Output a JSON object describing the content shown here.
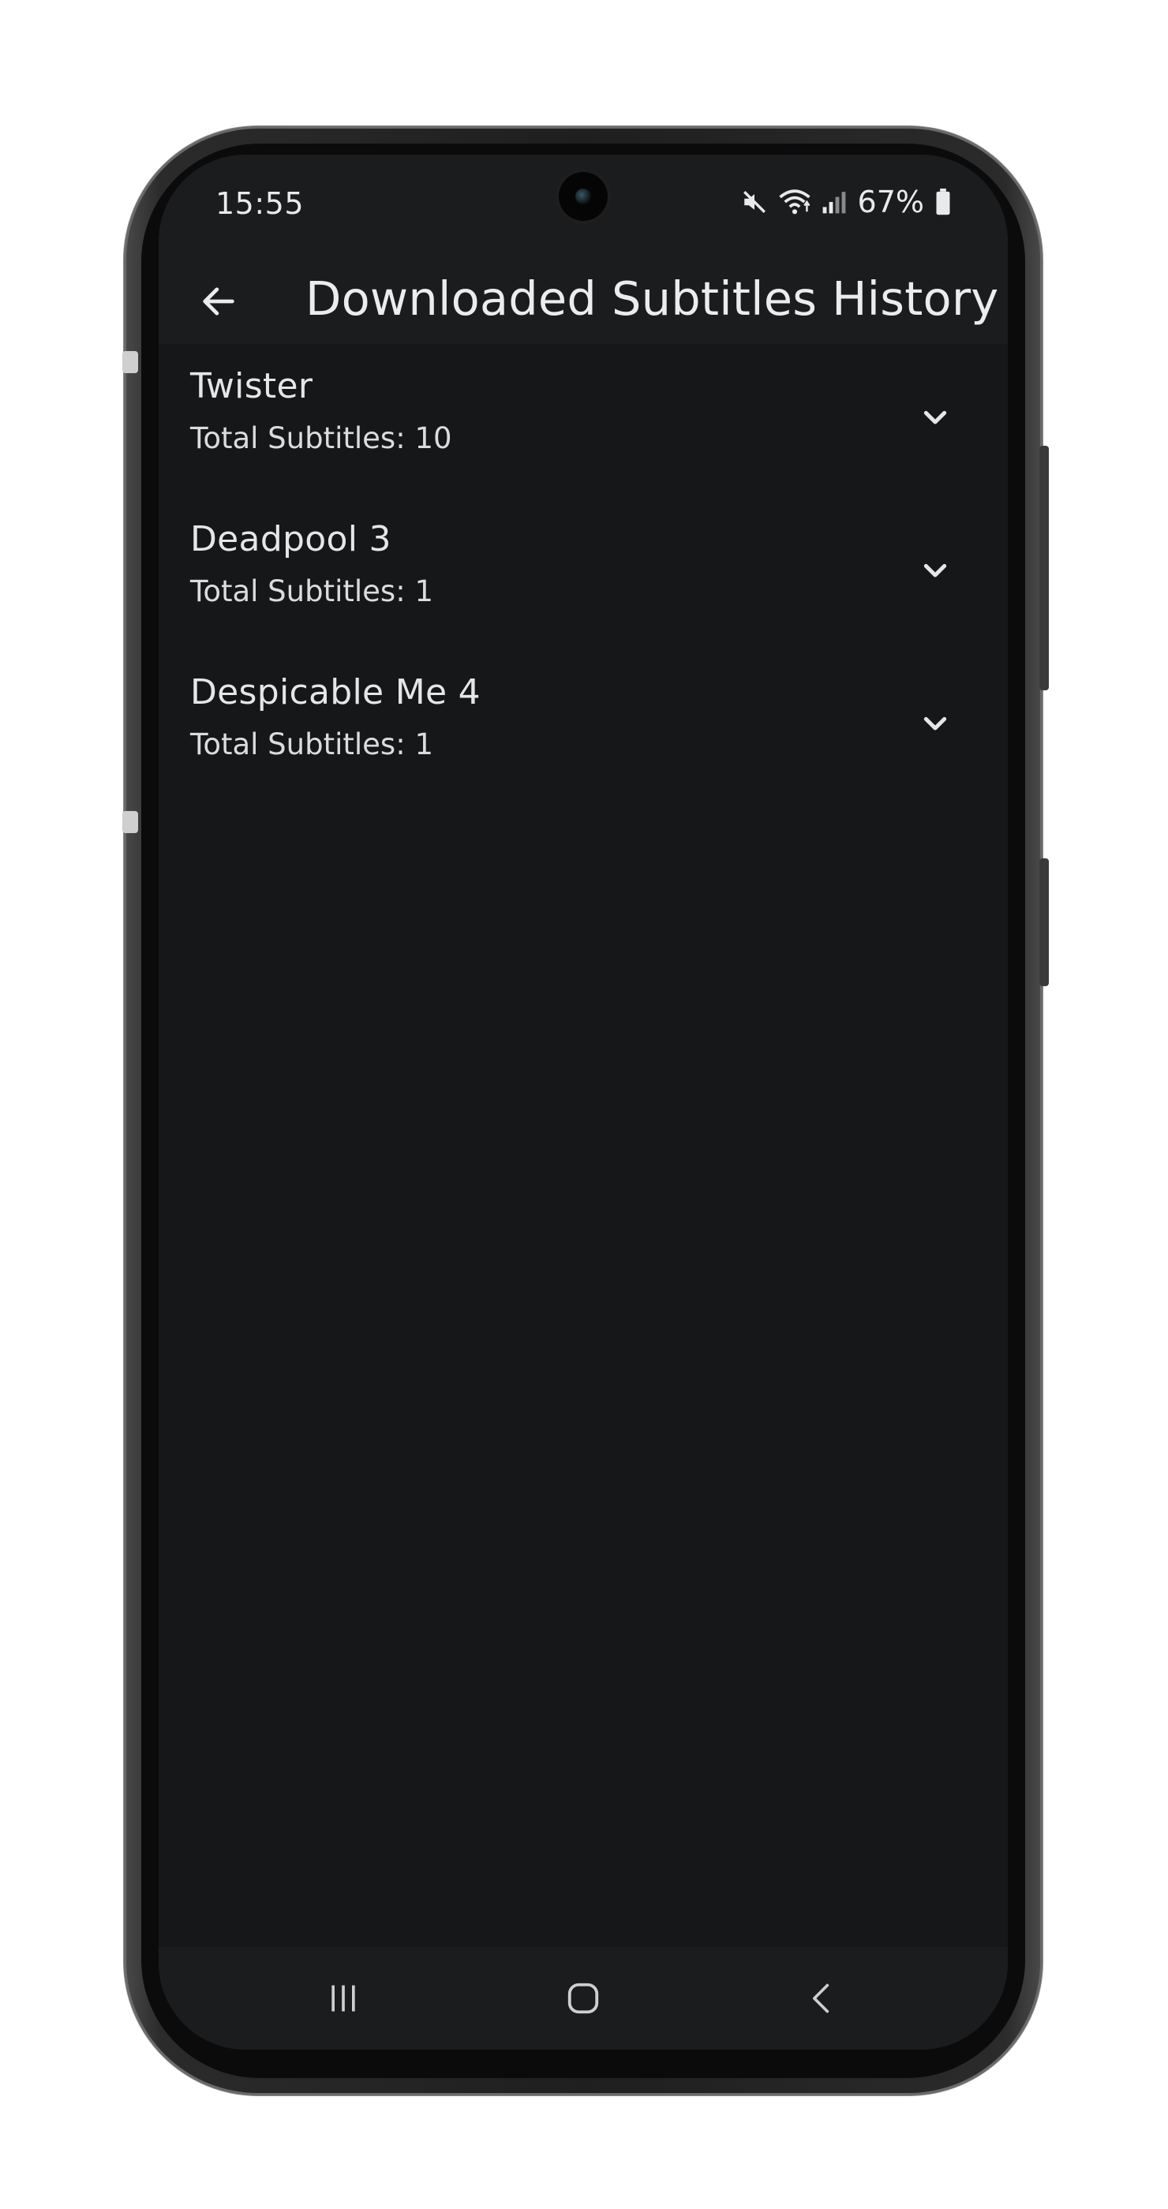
{
  "status_bar": {
    "time": "15:55",
    "battery": "67%",
    "icons": [
      "mute-icon",
      "wifi-icon",
      "signal-icon",
      "battery-icon"
    ]
  },
  "app_bar": {
    "title": "Downloaded Subtitles History",
    "back_icon": "arrow-back-icon"
  },
  "history": {
    "items": [
      {
        "title": "Twister",
        "subtitle": "Total Subtitles: 10",
        "icon": "chevron-down-icon"
      },
      {
        "title": "Deadpool 3",
        "subtitle": "Total Subtitles: 1",
        "icon": "chevron-down-icon"
      },
      {
        "title": "Despicable Me 4",
        "subtitle": "Total Subtitles: 1",
        "icon": "chevron-down-icon"
      }
    ]
  },
  "nav_bar": {
    "icons": [
      "recents-icon",
      "home-icon",
      "back-nav-icon"
    ]
  },
  "colors": {
    "background": "#161719",
    "bar": "#1a1c1e",
    "text": "#e6e6e6"
  }
}
